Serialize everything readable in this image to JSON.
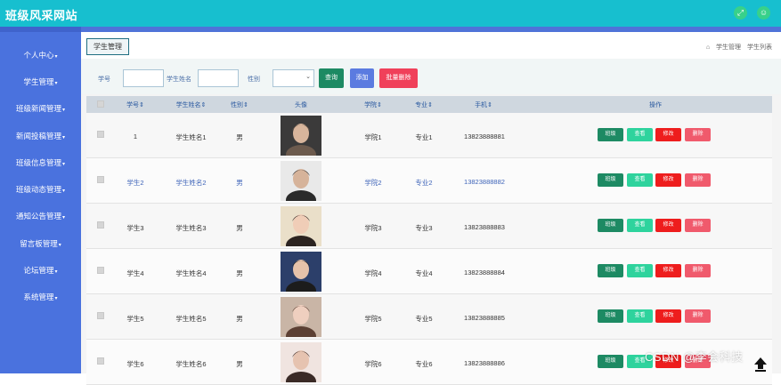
{
  "app": {
    "title": "班级风采网站"
  },
  "topbar": {
    "icons": [
      "expand-icon",
      "user-icon"
    ]
  },
  "sidebar": {
    "items": [
      {
        "label": "个人中心"
      },
      {
        "label": "学生管理"
      },
      {
        "label": "班级新闻管理"
      },
      {
        "label": "新闻投稿管理"
      },
      {
        "label": "班级信息管理"
      },
      {
        "label": "班级动态管理"
      },
      {
        "label": "通知公告管理"
      },
      {
        "label": "留言板管理"
      },
      {
        "label": "论坛管理"
      },
      {
        "label": "系统管理"
      }
    ]
  },
  "breadcrumb": {
    "current_button": "学生管理",
    "home_icon": "home-icon",
    "path": [
      "学生管理",
      "学生列表"
    ]
  },
  "filter": {
    "labels": {
      "student_no": "学号",
      "student_name": "学生姓名",
      "gender": "性别"
    },
    "search_btn": "查询",
    "add_btn": "添加",
    "batch_delete_btn": "批量删除"
  },
  "table": {
    "headers": [
      "学号",
      "学生姓名",
      "性别",
      "头像",
      "学院",
      "专业",
      "手机",
      "操作"
    ],
    "rows": [
      {
        "no": "1",
        "name": "学生姓名1",
        "gender": "男",
        "college": "学院1",
        "major": "专业1",
        "phone": "13823888881"
      },
      {
        "no": "学生2",
        "name": "学生姓名2",
        "gender": "男",
        "college": "学院2",
        "major": "专业2",
        "phone": "13823888882"
      },
      {
        "no": "学生3",
        "name": "学生姓名3",
        "gender": "男",
        "college": "学院3",
        "major": "专业3",
        "phone": "13823888883"
      },
      {
        "no": "学生4",
        "name": "学生姓名4",
        "gender": "男",
        "college": "学院4",
        "major": "专业4",
        "phone": "13823888884"
      },
      {
        "no": "学生5",
        "name": "学生姓名5",
        "gender": "男",
        "college": "学院5",
        "major": "专业5",
        "phone": "13823888885"
      },
      {
        "no": "学生6",
        "name": "学生姓名6",
        "gender": "男",
        "college": "学院6",
        "major": "专业6",
        "phone": "13823888886"
      }
    ],
    "actions": [
      "班级",
      "查看",
      "修改",
      "删除"
    ]
  },
  "watermark": "CSDN @李会科技",
  "colors": {
    "topbar": "#17bfcf",
    "sidebar": "#4a72de",
    "search": "#1d8a63",
    "add": "#5b7be0",
    "batch_delete": "#f0405a"
  }
}
